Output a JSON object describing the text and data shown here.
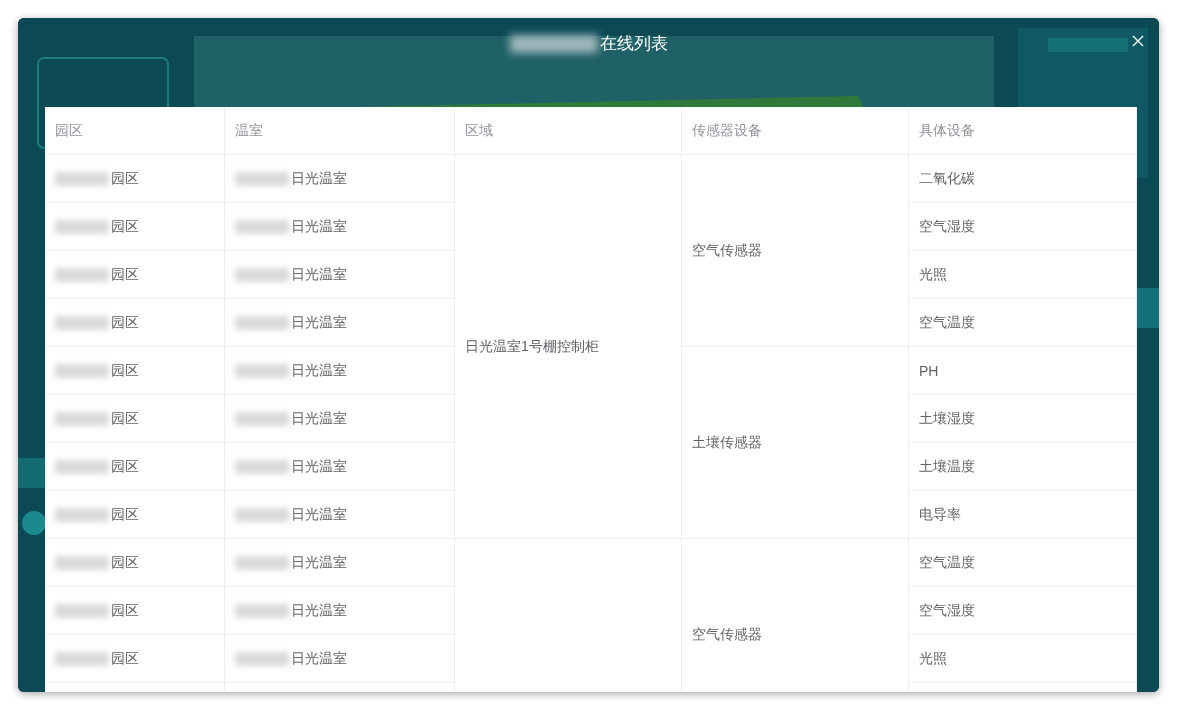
{
  "dialog": {
    "title": "在线列表"
  },
  "table": {
    "columns": [
      "园区",
      "温室",
      "区域",
      "传感器设备",
      "具体设备"
    ],
    "areas": [
      {
        "name": "日光温室1号棚控制柜",
        "sensors": [
          {
            "name": "空气传感器",
            "devices": [
              {
                "park": "园区",
                "greenhouse": "日光温室",
                "device": "二氧化碳"
              },
              {
                "park": "园区",
                "greenhouse": "日光温室",
                "device": "空气湿度"
              },
              {
                "park": "园区",
                "greenhouse": "日光温室",
                "device": "光照"
              },
              {
                "park": "园区",
                "greenhouse": "日光温室",
                "device": "空气温度"
              }
            ]
          },
          {
            "name": "土壤传感器",
            "devices": [
              {
                "park": "园区",
                "greenhouse": "日光温室",
                "device": "PH"
              },
              {
                "park": "园区",
                "greenhouse": "日光温室",
                "device": "土壤湿度"
              },
              {
                "park": "园区",
                "greenhouse": "日光温室",
                "device": "土壤温度"
              },
              {
                "park": "园区",
                "greenhouse": "日光温室",
                "device": "电导率"
              }
            ]
          }
        ]
      },
      {
        "sensors": [
          {
            "name": "空气传感器",
            "devices": [
              {
                "park": "园区",
                "greenhouse": "日光温室",
                "device": "空气温度"
              },
              {
                "park": "园区",
                "greenhouse": "日光温室",
                "device": "空气湿度"
              },
              {
                "park": "园区",
                "greenhouse": "日光温室",
                "device": "光照"
              }
            ]
          }
        ]
      }
    ]
  }
}
